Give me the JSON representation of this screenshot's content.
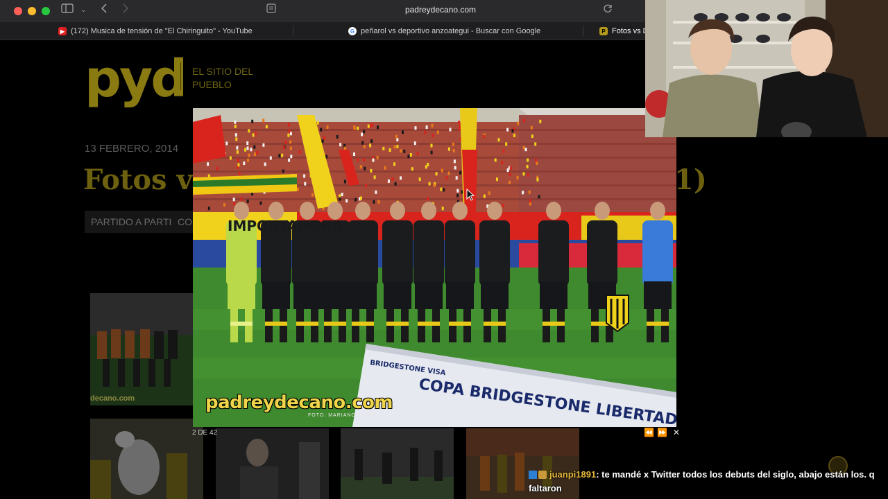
{
  "browser": {
    "url": "padreydecano.com",
    "tabs": [
      {
        "label": "(172) Musica de tensión de \"El Chiringuito\" - YouTube",
        "favicon": "youtube-icon"
      },
      {
        "label": "peñarol vs deportivo anzoategui - Buscar con Google",
        "favicon": "google-icon"
      },
      {
        "label": "Fotos vs De",
        "favicon": "pyd-icon"
      }
    ]
  },
  "site": {
    "logo": "pyd",
    "tagline": "EL SITIO DEL PUEBLO",
    "post_date": "13 FEBRERO, 2014",
    "post_title_start": "Fotos vs",
    "post_title_end": "1)",
    "categories": [
      "PARTIDO A PARTIDO",
      "COP"
    ],
    "thumb_watermark": "decano.com"
  },
  "lightbox": {
    "watermark": "padreydecano.com",
    "credit": "FOTO: MARIANO ALVEZ",
    "counter": "2 DE 42",
    "controls": {
      "prev": "⏪",
      "next": "⏩",
      "close": "✕"
    },
    "banner_text": "COPA BRIDGESTONE LIBERTADORES",
    "sponsor_text": "BRIDGESTONE  VISA",
    "ad_board_text": "IMPORTADORA"
  },
  "chat": {
    "username": "juanpi1891",
    "message": ": te mandé x Twitter todos los debuts del siglo, abajo están los. q faltaron"
  },
  "colors": {
    "brand_gold": "#8a7a12",
    "chat_user": "#e7b83a",
    "chrome_bg": "#2a2a2c"
  }
}
